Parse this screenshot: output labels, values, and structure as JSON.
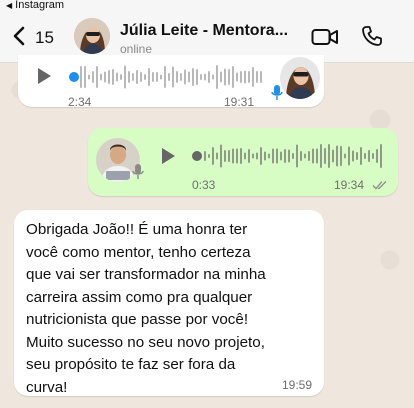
{
  "statusbar": {
    "back_app": "Instagram"
  },
  "header": {
    "unread_count": "15",
    "contact_name": "Júlia Leite - Mentora...",
    "status": "online"
  },
  "messages": [
    {
      "type": "audio",
      "direction": "incoming",
      "duration": "2:34",
      "time": "19:31"
    },
    {
      "type": "audio",
      "direction": "outgoing",
      "duration": "0:33",
      "time": "19:34"
    },
    {
      "type": "text",
      "direction": "incoming",
      "text": "Obrigada João!! É uma honra ter\nvocê como mentor, tenho certeza\nque vai ser transformador na minha\ncarreira assim como pra qualquer\nnutricionista que passe por você!\nMuito sucesso no seu novo projeto,\nseu propósito te faz ser fora da\ncurva!",
      "time": "19:59"
    }
  ],
  "colors": {
    "outgoing_bubble": "#d8fdc4",
    "incoming_bubble": "#ffffff",
    "audio_dot_incoming": "#1f8ef1",
    "mic_blue": "#1f8ef1"
  },
  "icons": [
    "back-chevron-icon",
    "video-call-icon",
    "phone-call-icon",
    "play-icon",
    "mic-icon",
    "double-check-icon"
  ]
}
